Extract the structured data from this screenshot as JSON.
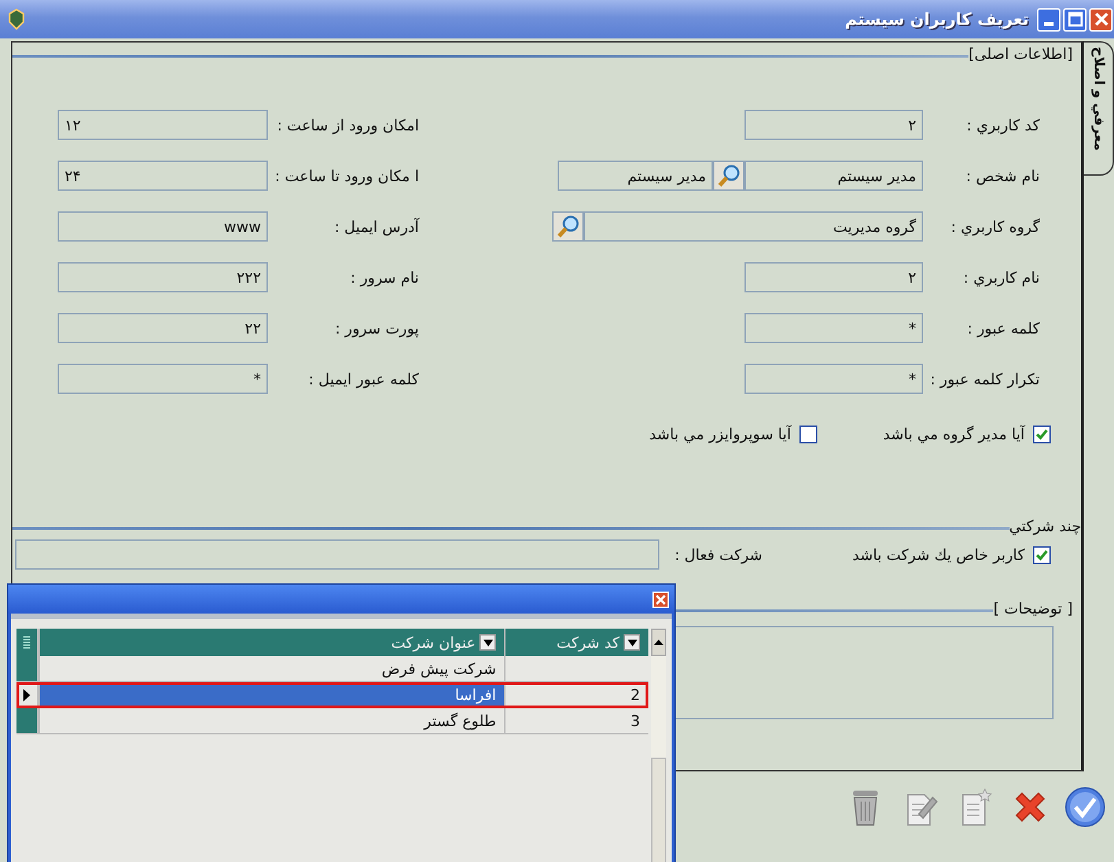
{
  "window": {
    "title": "تعريف كاربران سيستم"
  },
  "side_tab": {
    "label": "معرفي و اصلاح",
    "selected": true
  },
  "main_section": {
    "title": "[اطلاعات اصلی]",
    "right_fields": [
      {
        "label": "كد كاربري :",
        "value": "۲",
        "kind": "text"
      },
      {
        "label": "نام شخص :",
        "value": "مدير سيستم",
        "kind": "lookup-pair",
        "extra": "مدير سيستم"
      },
      {
        "label": "گروه كاربري :",
        "value": "گروه مديريت",
        "kind": "lookup"
      },
      {
        "label": "نام كاربري :",
        "value": "۲",
        "kind": "text"
      },
      {
        "label": "كلمه عبور :",
        "value": "*",
        "kind": "text"
      },
      {
        "label": "تكرار كلمه عبور :",
        "value": "*",
        "kind": "text"
      }
    ],
    "left_fields": [
      {
        "label": "امكان ورود از ساعت :",
        "value": "۱۲",
        "kind": "time"
      },
      {
        "label": "ا مكان ورود تا ساعت :",
        "value": "۲۴",
        "kind": "time"
      },
      {
        "label": "آدرس ايميل :",
        "value": "www",
        "kind": "text"
      },
      {
        "label": "نام سرور :",
        "value": "۲۲۲",
        "kind": "text"
      },
      {
        "label": "پورت سرور :",
        "value": "۲۲",
        "kind": "text"
      },
      {
        "label": "كلمه عبور ايميل :",
        "value": "*",
        "kind": "text"
      }
    ],
    "checkboxes": [
      {
        "label": "آيا مدير گروه مي باشد",
        "checked": true
      },
      {
        "label": "آيا سوپروايزر مي باشد",
        "checked": false
      }
    ]
  },
  "multi_company": {
    "title": "چند شركتي",
    "checkbox": {
      "label": "كاربر خاص يك شركت باشد",
      "checked": true
    },
    "active_company_label": "شركت فعال :"
  },
  "description": {
    "title": "[ توضيحات ]"
  },
  "toolbar": [
    {
      "kind": "delete"
    },
    {
      "kind": "edit"
    },
    {
      "kind": "new"
    },
    {
      "kind": "cancel"
    },
    {
      "kind": "ok"
    }
  ],
  "popup": {
    "columns": [
      {
        "label": "كد شركت"
      },
      {
        "label": "عنوان شركت"
      }
    ],
    "rows": [
      {
        "title": "شركت پيش فرض",
        "selected": false
      },
      {
        "title": "افراسا",
        "code": "2",
        "selected": true
      },
      {
        "title": "طلوع گستر",
        "code": "3",
        "selected": false
      }
    ]
  }
}
